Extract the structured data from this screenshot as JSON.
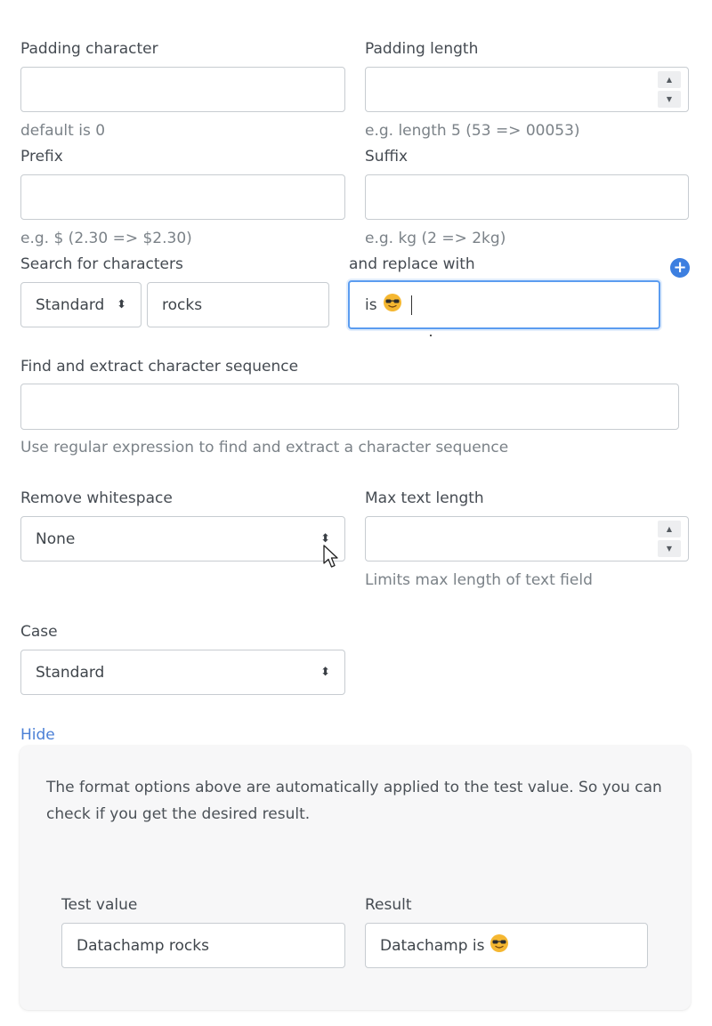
{
  "padding": {
    "char_label": "Padding character",
    "char_value": "",
    "char_help": "default is 0",
    "length_label": "Padding length",
    "length_value": "",
    "length_help": "e.g. length 5 (53 => 00053)"
  },
  "prefix": {
    "label": "Prefix",
    "value": "",
    "help": "e.g. $ (2.30 => $2.30)"
  },
  "suffix": {
    "label": "Suffix",
    "value": "",
    "help": "e.g. kg (2 => 2kg)"
  },
  "search": {
    "label": "Search for characters",
    "mode_value": "Standard",
    "search_value": "rocks",
    "replace_label": "and replace with",
    "replace_value": "is"
  },
  "extract": {
    "label": "Find and extract character sequence",
    "value": "",
    "help": "Use regular expression to find and extract a character sequence"
  },
  "whitespace": {
    "label": "Remove whitespace",
    "value": "None"
  },
  "maxlen": {
    "label": "Max text length",
    "value": "",
    "help": "Limits max length of text field"
  },
  "case": {
    "label": "Case",
    "value": "Standard"
  },
  "toggle": {
    "hide_label": "Hide"
  },
  "test": {
    "description": "The format options above are automatically applied to the test value. So you can check if you get the desired result.",
    "test_label": "Test value",
    "test_value": "Datachamp rocks",
    "result_label": "Result",
    "result_value": "Datachamp is"
  },
  "icons": {
    "add": "plus-circle-icon",
    "emoji": "smiling-face-with-sunglasses-icon",
    "spin_up": "caret-up-icon",
    "spin_down": "caret-down-icon",
    "select": "sort-caret-icon",
    "cursor": "mouse-pointer-icon"
  },
  "colors": {
    "accent": "#3d7fe0",
    "link": "#4a7fd6",
    "focus_border": "#5b9cf0",
    "panel_bg": "#f7f7f8"
  }
}
